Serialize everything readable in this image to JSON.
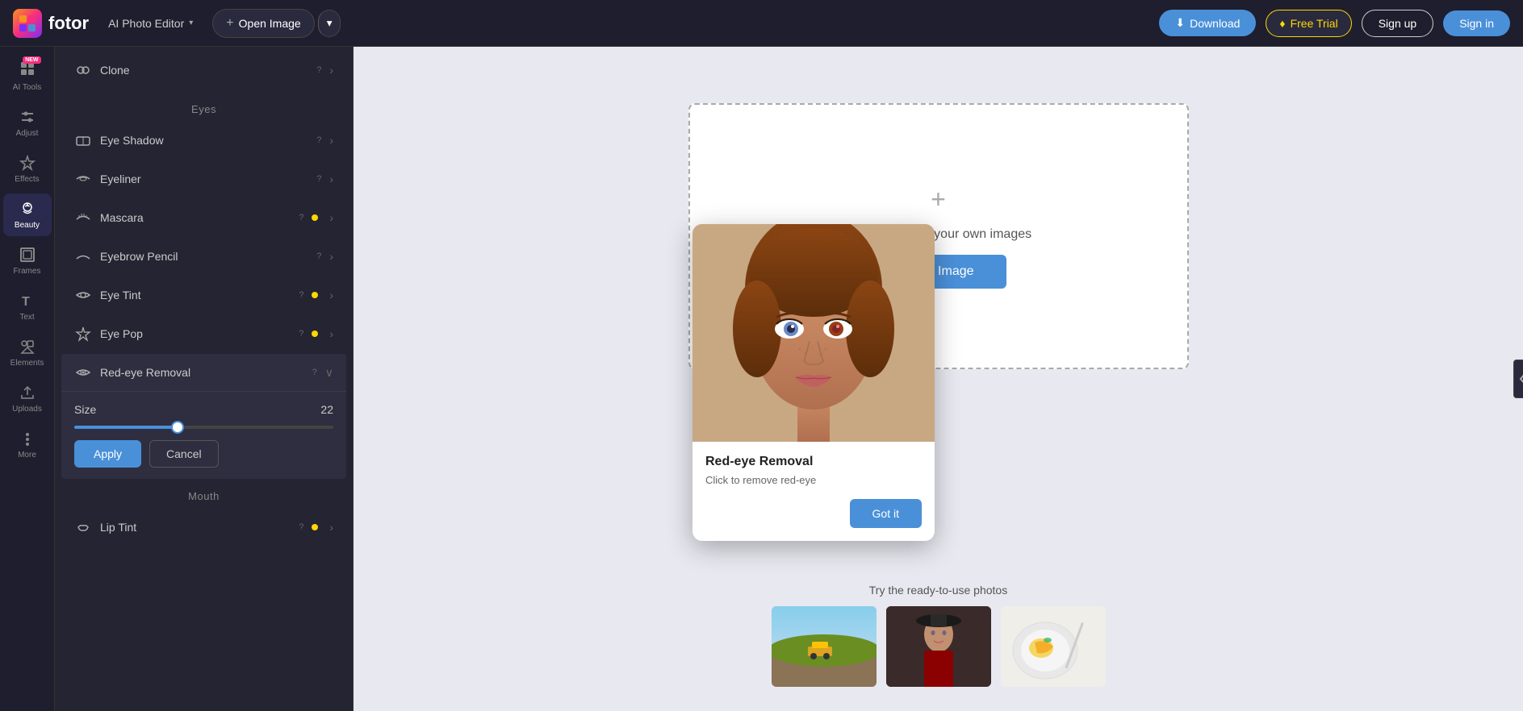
{
  "header": {
    "logo_text": "fotor",
    "app_title": "AI Photo Editor",
    "open_image_label": "Open Image",
    "download_label": "Download",
    "free_trial_label": "Free Trial",
    "sign_up_label": "Sign up",
    "sign_in_label": "Sign in"
  },
  "sidebar": {
    "items": [
      {
        "id": "ai-tools",
        "label": "AI Tools",
        "icon": "ai",
        "has_new": true
      },
      {
        "id": "adjust",
        "label": "Adjust",
        "icon": "adjust"
      },
      {
        "id": "effects",
        "label": "Effects",
        "icon": "effects"
      },
      {
        "id": "beauty",
        "label": "Beauty",
        "icon": "beauty"
      },
      {
        "id": "frames",
        "label": "Frames",
        "icon": "frames"
      },
      {
        "id": "text",
        "label": "Text",
        "icon": "text"
      },
      {
        "id": "elements",
        "label": "Elements",
        "icon": "elements"
      },
      {
        "id": "uploads",
        "label": "Uploads",
        "icon": "uploads"
      },
      {
        "id": "more",
        "label": "More",
        "icon": "more"
      }
    ]
  },
  "tools_panel": {
    "clone_label": "Clone",
    "eyes_section": "Eyes",
    "tools": [
      {
        "id": "eye-shadow",
        "label": "Eye Shadow",
        "has_dot": false,
        "expanded": false
      },
      {
        "id": "eyeliner",
        "label": "Eyeliner",
        "has_dot": false,
        "expanded": false
      },
      {
        "id": "mascara",
        "label": "Mascara",
        "has_dot": true,
        "expanded": false
      },
      {
        "id": "eyebrow-pencil",
        "label": "Eyebrow Pencil",
        "has_dot": false,
        "expanded": false
      },
      {
        "id": "eye-tint",
        "label": "Eye Tint",
        "has_dot": true,
        "expanded": false
      },
      {
        "id": "eye-pop",
        "label": "Eye Pop",
        "has_dot": true,
        "expanded": false
      },
      {
        "id": "red-eye-removal",
        "label": "Red-eye Removal",
        "has_dot": false,
        "expanded": true
      }
    ],
    "size_label": "Size",
    "size_value": "22",
    "slider_percent": 40,
    "apply_label": "Apply",
    "cancel_label": "Cancel",
    "mouth_section": "Mouth",
    "mouth_tools": [
      {
        "id": "lip-tint",
        "label": "Lip Tint",
        "has_dot": true,
        "expanded": false
      }
    ]
  },
  "canvas": {
    "upload_text": "Drag or upload your own images",
    "open_image_label": "Open Image",
    "ready_text": "Try the ready-to-use photos"
  },
  "popup": {
    "title": "Red-eye Removal",
    "description": "Click to remove red-eye",
    "got_it_label": "Got it"
  },
  "colors": {
    "primary": "#4a90d9",
    "bg_dark": "#1e1e2e",
    "bg_panel": "#242432",
    "accent_yellow": "#ffd700",
    "accent_pink": "#f72d7e"
  }
}
